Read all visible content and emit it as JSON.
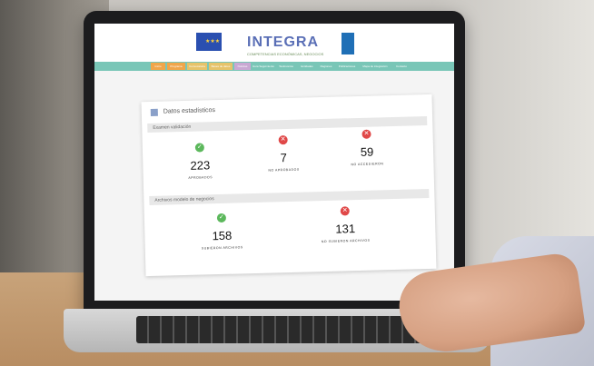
{
  "header": {
    "logo_text": "INTEGRA",
    "logo_subtitle": "COMPETENCIAS ECONÓMICAS, NEGOCIOS"
  },
  "nav": {
    "items": [
      "Inicio",
      "Programa",
      "Convocatoria",
      "Bases de datos",
      "Noticias",
      "Guía Seguimiento",
      "Testimonios",
      "Entidades",
      "Regiones",
      "Publicaciones",
      "Mapa de integración",
      "Contacto"
    ]
  },
  "panel": {
    "title": "Datos estadísticos",
    "section1": {
      "title": "Examen validación",
      "stats": [
        {
          "value": "223",
          "label": "APROBADOS",
          "status": "ok"
        },
        {
          "value": "7",
          "label": "NO APROBADOS",
          "status": "fail"
        },
        {
          "value": "59",
          "label": "NO ACCEDIERON",
          "status": "fail"
        }
      ]
    },
    "section2": {
      "title": "Archivos modelo de negocios",
      "stats": [
        {
          "value": "158",
          "label": "SUBIERON ARCHIVOS",
          "status": "ok"
        },
        {
          "value": "131",
          "label": "NO SUBIERON ARCHIVOS",
          "status": "fail"
        }
      ]
    }
  },
  "colors": {
    "accent_green": "#5cb85c",
    "accent_red": "#e04848",
    "nav_teal": "#79c6b7"
  }
}
